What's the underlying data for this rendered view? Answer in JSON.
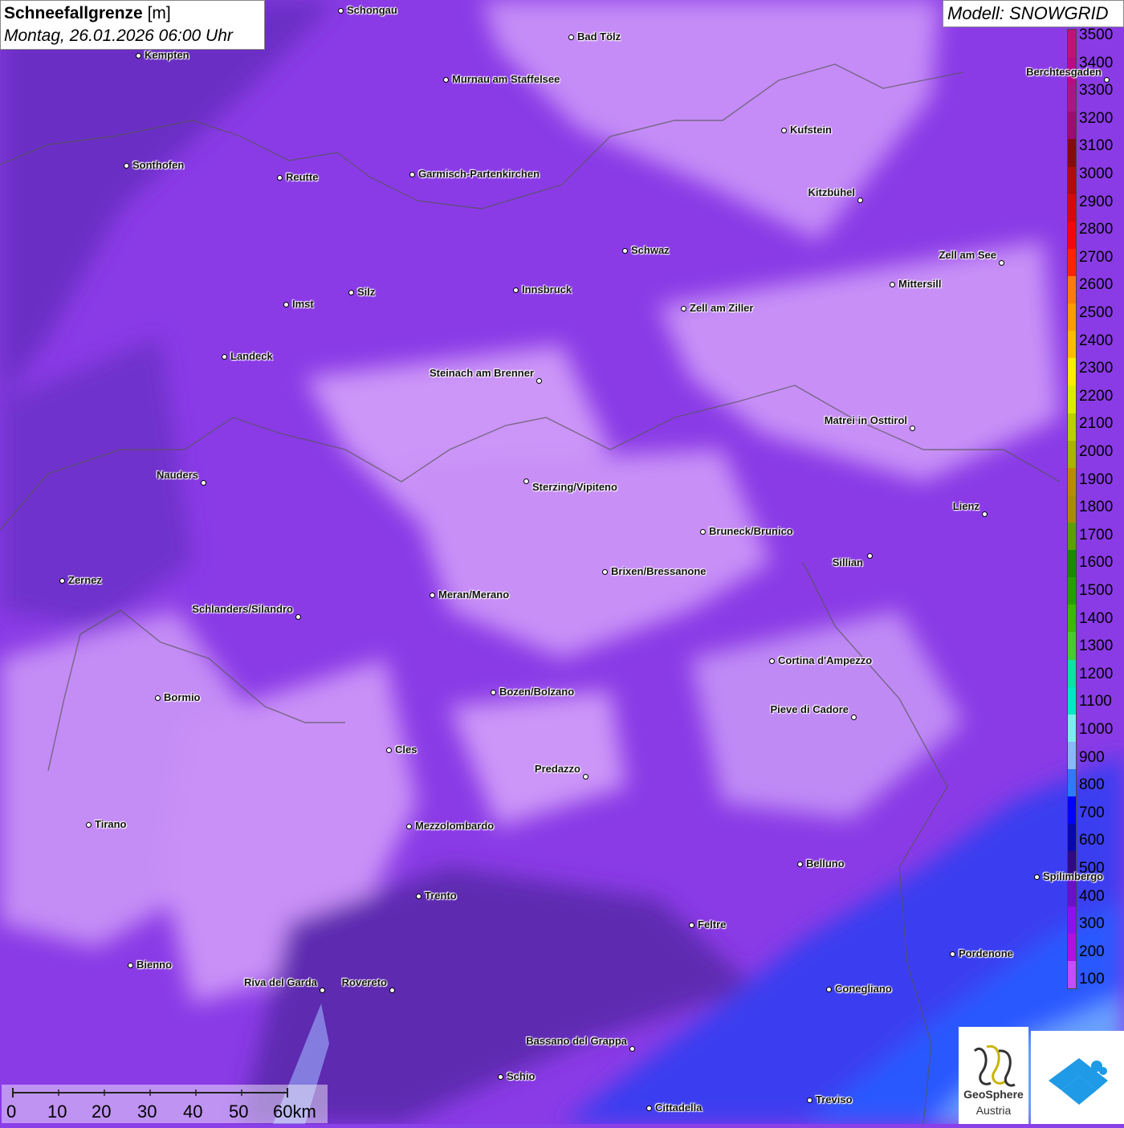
{
  "header": {
    "title": "Schneefallgrenze",
    "unit": "[m]",
    "datetime": "Montag, 26.01.2026 06:00 Uhr",
    "model": "Modell: SNOWGRID"
  },
  "legend": {
    "levels": [
      "3500",
      "3400",
      "3300",
      "3200",
      "3100",
      "3000",
      "2900",
      "2800",
      "2700",
      "2600",
      "2500",
      "2400",
      "2300",
      "2200",
      "2100",
      "2000",
      "1900",
      "1800",
      "1700",
      "1600",
      "1500",
      "1400",
      "1300",
      "1200",
      "1100",
      "1000",
      "900",
      "800",
      "700",
      "600",
      "500",
      "400",
      "300",
      "200",
      "100"
    ],
    "colors": [
      "#c2127a",
      "#ba0a86",
      "#ab1588",
      "#9e0b73",
      "#880b0b",
      "#b30a0a",
      "#d40a0a",
      "#ec0a0a",
      "#ff2400",
      "#ff7a0a",
      "#ff9a00",
      "#ffbb00",
      "#ffee00",
      "#dcec00",
      "#b8d000",
      "#a8b400",
      "#bc8a00",
      "#a88c00",
      "#5aa000",
      "#1a8a00",
      "#23a000",
      "#3bb800",
      "#44cc30",
      "#10e0a0",
      "#00e8c8",
      "#78f0f0",
      "#8ab8ff",
      "#2e7aff",
      "#0000ff",
      "#0808b0",
      "#300a80",
      "#6a10c8",
      "#8c10f0",
      "#b010e0",
      "#c050ff"
    ]
  },
  "cities": [
    {
      "name": "Schongau"
    },
    {
      "name": "Bad Tölz"
    },
    {
      "name": "Kempten"
    },
    {
      "name": "Murnau am Staffelsee"
    },
    {
      "name": "Berchtesgaden"
    },
    {
      "name": "Kufstein"
    },
    {
      "name": "Sonthofen"
    },
    {
      "name": "Reutte"
    },
    {
      "name": "Garmisch-Partenkirchen"
    },
    {
      "name": "Kitzbühel"
    },
    {
      "name": "Schwaz"
    },
    {
      "name": "Zell am See"
    },
    {
      "name": "Innsbruck"
    },
    {
      "name": "Mittersill"
    },
    {
      "name": "Imst"
    },
    {
      "name": "Silz"
    },
    {
      "name": "Zell am Ziller"
    },
    {
      "name": "Landeck"
    },
    {
      "name": "Steinach am Brenner"
    },
    {
      "name": "Matrei in Osttirol"
    },
    {
      "name": "Nauders"
    },
    {
      "name": "Sterzing/Vipiteno"
    },
    {
      "name": "Lienz"
    },
    {
      "name": "Bruneck/Brunico"
    },
    {
      "name": "Sillian"
    },
    {
      "name": "Zernez"
    },
    {
      "name": "Brixen/Bressanone"
    },
    {
      "name": "Meran/Merano"
    },
    {
      "name": "Schlanders/Silandro"
    },
    {
      "name": "Cortina d'Ampezzo"
    },
    {
      "name": "Bozen/Bolzano"
    },
    {
      "name": "Bormio"
    },
    {
      "name": "Pieve di Cadore"
    },
    {
      "name": "Cles"
    },
    {
      "name": "Predazzo"
    },
    {
      "name": "Tirano"
    },
    {
      "name": "Mezzolombardo"
    },
    {
      "name": "Belluno"
    },
    {
      "name": "Spilimbergo"
    },
    {
      "name": "Trento"
    },
    {
      "name": "Feltre"
    },
    {
      "name": "Pordenone"
    },
    {
      "name": "Bienno"
    },
    {
      "name": "Riva del Garda"
    },
    {
      "name": "Rovereto"
    },
    {
      "name": "Conegliano"
    },
    {
      "name": "Bassano del Grappa"
    },
    {
      "name": "Schio"
    },
    {
      "name": "Treviso"
    },
    {
      "name": "Cittadella"
    }
  ],
  "scale": {
    "ticks": [
      "0",
      "10",
      "20",
      "30",
      "40",
      "50",
      "60km"
    ]
  },
  "logo": {
    "name1": "GeoSphere",
    "name2": "Austria"
  }
}
